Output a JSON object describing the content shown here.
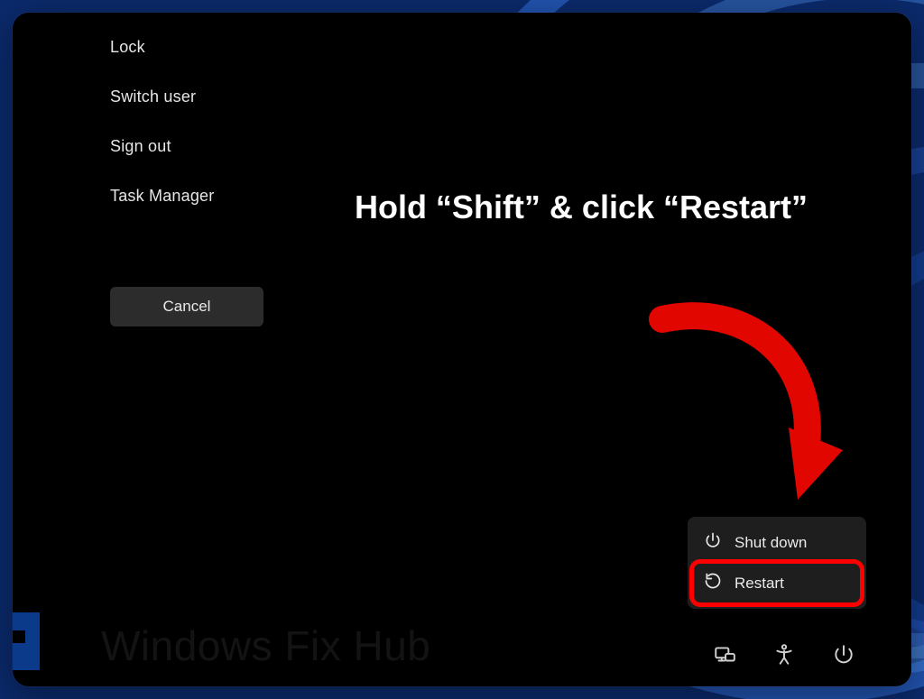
{
  "menu": {
    "items": [
      {
        "label": "Lock"
      },
      {
        "label": "Switch user"
      },
      {
        "label": "Sign out"
      },
      {
        "label": "Task Manager"
      }
    ],
    "cancel_label": "Cancel"
  },
  "instruction": {
    "text": "Hold “Shift” & click “Restart”"
  },
  "power_popup": {
    "shutdown_label": "Shut down",
    "restart_label": "Restart"
  },
  "watermark": {
    "text": "Windows Fix Hub"
  },
  "colors": {
    "highlight": "#ff0000",
    "arrow": "#e10600"
  }
}
